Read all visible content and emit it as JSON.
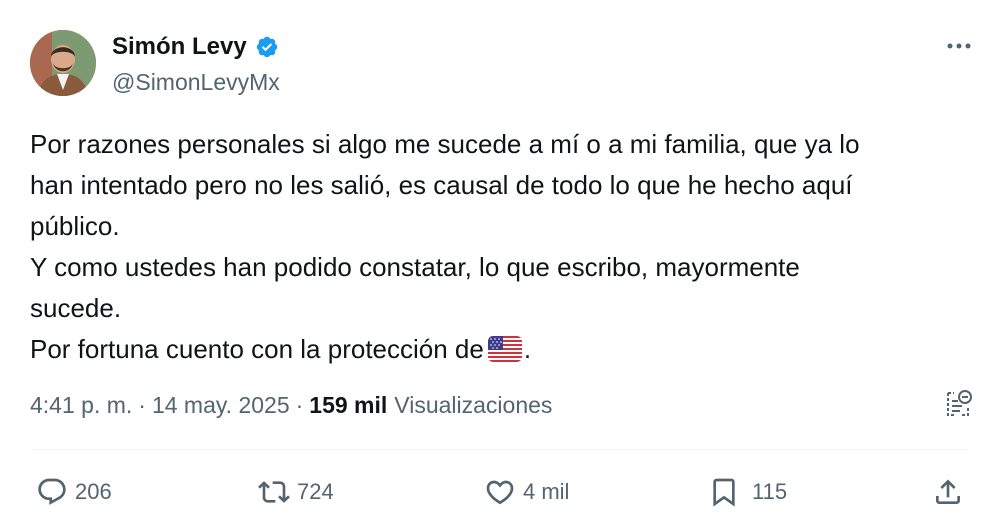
{
  "author": {
    "name": "Simón Levy",
    "handle": "@SimonLevyMx",
    "avatar_icon": "avatar-photo",
    "verified_icon": "verified-badge-icon",
    "verified_color": "#1d9bf0"
  },
  "tweet": {
    "lines": [
      "Por razones personales si algo me sucede a mí o a mi familia, que ya lo",
      "han intentado pero no les salió, es causal de todo lo que he hecho aquí",
      "público.",
      "Y como ustedes han podido constatar, lo que escribo, mayormente",
      "sucede.",
      "Por fortuna cuento con la protección de"
    ],
    "last_line_suffix": ".",
    "flag_icon": "us-flag-icon"
  },
  "meta": {
    "time": "4:41 p. m.",
    "separator": "·",
    "date": "14 may. 2025",
    "views_count": "159 mil",
    "views_label": "Visualizaciones"
  },
  "actions": {
    "replies": "206",
    "reposts": "724",
    "likes": "4 mil",
    "bookmarks": "115"
  },
  "colors": {
    "text": "#0f1419",
    "secondary": "#536471",
    "accent": "#1d9bf0",
    "divider": "#eff3f4"
  }
}
